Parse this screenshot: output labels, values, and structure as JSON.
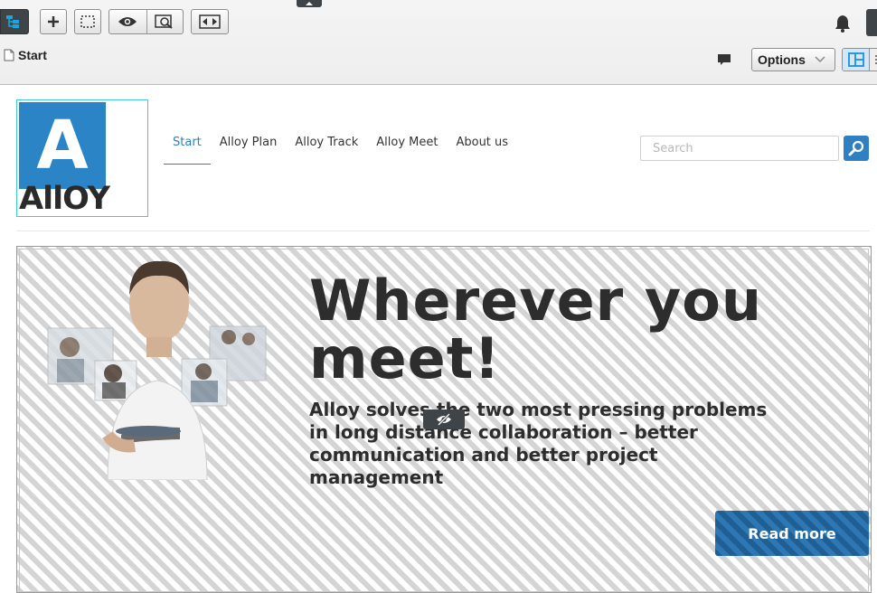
{
  "toolbar": {
    "page_name": "Start",
    "options_label": "Options"
  },
  "site": {
    "logo_letter": "A",
    "logo_word": "AllOY",
    "nav": [
      {
        "label": "Start",
        "active": true
      },
      {
        "label": "Alloy Plan",
        "active": false
      },
      {
        "label": "Alloy Track",
        "active": false
      },
      {
        "label": "Alloy Meet",
        "active": false
      },
      {
        "label": "About us",
        "active": false
      }
    ],
    "search_placeholder": "Search"
  },
  "hero": {
    "title": "Wherever you meet!",
    "subtitle": "Alloy solves the two most pressing problems in long distance collaboration – better communication and better project management",
    "button_label": "Read more"
  },
  "colors": {
    "accent": "#2d7fbf",
    "logo_blue": "#2b84c6",
    "toolbar_dark": "#3f4448",
    "logo_border": "#3cc9d9"
  }
}
